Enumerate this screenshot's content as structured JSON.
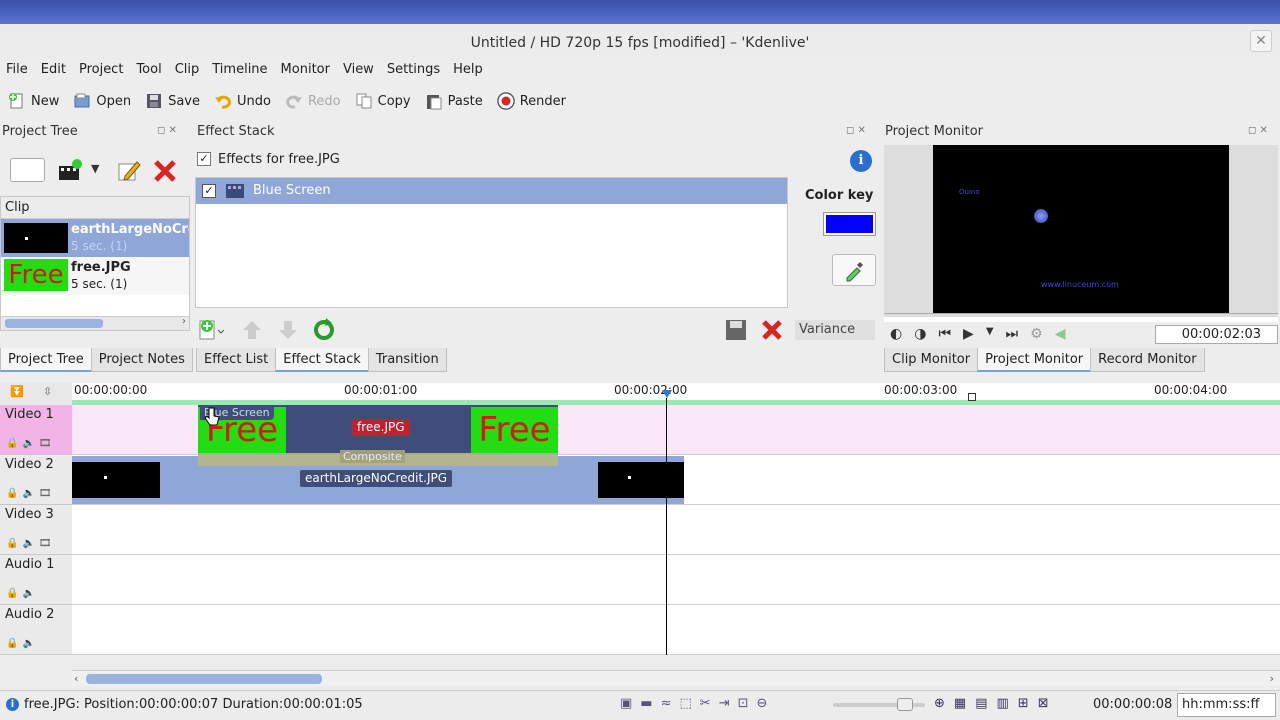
{
  "window": {
    "title": "Untitled / HD 720p 15 fps [modified] – 'Kdenlive'",
    "close_glyph": "✕"
  },
  "menu": [
    "File",
    "Edit",
    "Project",
    "Tool",
    "Clip",
    "Timeline",
    "Monitor",
    "View",
    "Settings",
    "Help"
  ],
  "toolbar": {
    "new": "New",
    "open": "Open",
    "save": "Save",
    "undo": "Undo",
    "redo": "Redo",
    "copy": "Copy",
    "paste": "Paste",
    "render": "Render"
  },
  "project_tree": {
    "title": "Project Tree",
    "column_header": "Clip",
    "clips": [
      {
        "name": "earthLargeNoCre",
        "sub": "5 sec. (1)"
      },
      {
        "name": "free.JPG",
        "sub": "5 sec. (1)",
        "thumb_text": "Free"
      }
    ]
  },
  "effect_stack": {
    "title": "Effect Stack",
    "effects_for": "Effects for free.JPG",
    "effects": [
      "Blue Screen"
    ],
    "color_key_label": "Color key",
    "color_key_value": "#0000ff",
    "variance_label": "Variance"
  },
  "project_monitor": {
    "title": "Project Monitor",
    "timecode": "00:00:02:03",
    "watermark": "www.linuceum.com",
    "small_text": "Ouino"
  },
  "tabs_left": [
    "Project Tree",
    "Project Notes"
  ],
  "tabs_mid": [
    "Effect List",
    "Effect Stack",
    "Transition"
  ],
  "tabs_right": [
    "Clip Monitor",
    "Project Monitor",
    "Record Monitor"
  ],
  "ruler": [
    "00:00:00:00",
    "00:00:01:00",
    "00:00:02:00",
    "00:00:03:00",
    "00:00:04:00"
  ],
  "tracks": [
    {
      "name": "Video 1"
    },
    {
      "name": "Video 2"
    },
    {
      "name": "Video 3"
    },
    {
      "name": "Audio 1"
    },
    {
      "name": "Audio 2"
    }
  ],
  "timeline_clips": {
    "v1_label": "free.JPG",
    "v1_effect": "Blue Screen",
    "v1_transition": "Composite",
    "v1_free_text": "Free",
    "v2_label": "earthLargeNoCredit.JPG"
  },
  "status": {
    "message": "free.JPG: Position:00:00:00:07 Duration:00:00:01:05",
    "timecode": "00:00:00:08",
    "format": "hh:mm:ss:ff"
  },
  "colors": {
    "accent": "#7aa0d8",
    "track_v1": "#fae8f8",
    "clip_blue": "#8ea6d8",
    "green": "#22dd11"
  }
}
